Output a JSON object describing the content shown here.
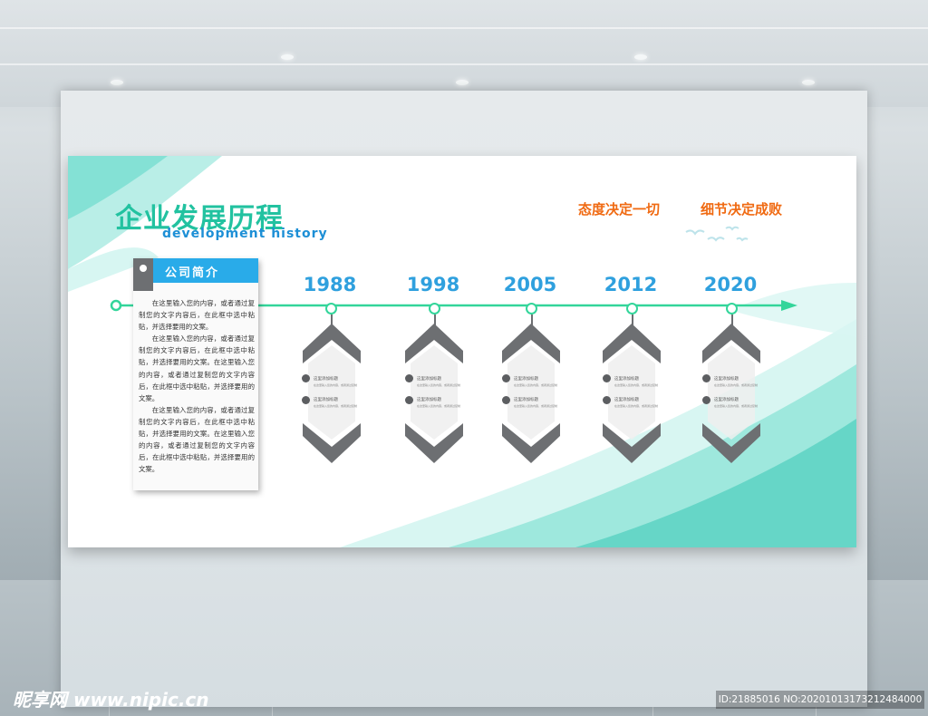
{
  "board": {
    "title_cn": "企业发展历程",
    "title_en": "development history",
    "slogans": [
      "态度决定一切",
      "细节决定成败"
    ]
  },
  "intro": {
    "title": "公司简介",
    "paragraphs": [
      "在这里输入您的内容，或者通过复制您的文字内容后，在此框中选中粘贴，并选择要用的文案。",
      "在这里输入您的内容，或者通过复制您的文字内容后，在此框中选中粘贴，并选择要用的文案。在这里输入您的内容，或者通过复制您的文字内容后，在此框中选中粘贴，并选择要用的文案。",
      "在这里输入您的内容，或者通过复制您的文字内容后，在此框中选中粘贴，并选择要用的文案。在这里输入您的内容，或者通过复制您的文字内容后，在此框中选中粘贴，并选择要用的文案。"
    ]
  },
  "timeline": [
    {
      "year": "1988",
      "items": [
        {
          "label": "这里添加标题",
          "text": "在这里输入您的内容，或者通过复制"
        },
        {
          "label": "这里添加标题",
          "text": "在这里输入您的内容，或者通过复制"
        }
      ]
    },
    {
      "year": "1998",
      "items": [
        {
          "label": "这里添加标题",
          "text": "在这里输入您的内容，或者通过复制"
        },
        {
          "label": "这里添加标题",
          "text": "在这里输入您的内容，或者通过复制"
        }
      ]
    },
    {
      "year": "2005",
      "items": [
        {
          "label": "这里添加标题",
          "text": "在这里输入您的内容，或者通过复制"
        },
        {
          "label": "这里添加标题",
          "text": "在这里输入您的内容，或者通过复制"
        }
      ]
    },
    {
      "year": "2012",
      "items": [
        {
          "label": "这里添加标题",
          "text": "在这里输入您的内容，或者通过复制"
        },
        {
          "label": "这里添加标题",
          "text": "在这里输入您的内容，或者通过复制"
        }
      ]
    },
    {
      "year": "2020",
      "items": [
        {
          "label": "这里添加标题",
          "text": "在这里输入您的内容，或者通过复制"
        },
        {
          "label": "这里添加标题",
          "text": "在这里输入您的内容，或者通过复制"
        }
      ]
    }
  ],
  "watermark": {
    "site": "昵享网 www.nipic.cn",
    "id": "ID:21885016 NO:20201013173212484000"
  },
  "colors": {
    "title_green": "#22c2a0",
    "accent_blue": "#29abe9",
    "year_blue": "#2fa0de",
    "slogan_orange": "#f06a12",
    "timeline_green": "#33d59a",
    "chevron_gray": "#6d6f72"
  },
  "icons": [
    "bird-icon",
    "user-icon",
    "photo-icon"
  ]
}
